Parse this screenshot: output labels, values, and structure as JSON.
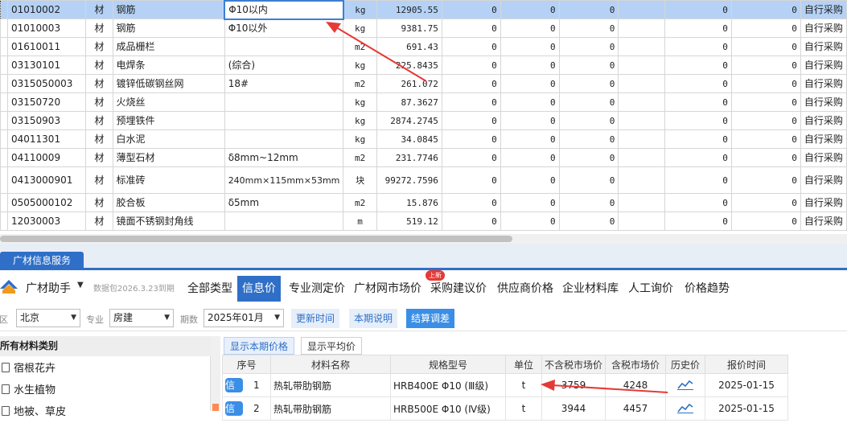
{
  "grid": {
    "rows": [
      {
        "code": "01010002",
        "type": "材",
        "name": "钢筋",
        "spec": "Φ10以内",
        "unit": "kg",
        "qty": "12905.55",
        "c1": "0",
        "c2": "0",
        "c3": "0",
        "c4": "",
        "c5": "0",
        "c6": "0",
        "supply": "自行采购",
        "selected": true,
        "tall": false
      },
      {
        "code": "01010003",
        "type": "材",
        "name": "钢筋",
        "spec": "Φ10以外",
        "unit": "kg",
        "qty": "9381.75",
        "c1": "0",
        "c2": "0",
        "c3": "0",
        "c4": "",
        "c5": "0",
        "c6": "0",
        "supply": "自行采购",
        "selected": false,
        "tall": false
      },
      {
        "code": "01610011",
        "type": "材",
        "name": "成品栅栏",
        "spec": "",
        "unit": "m2",
        "qty": "691.43",
        "c1": "0",
        "c2": "0",
        "c3": "0",
        "c4": "",
        "c5": "0",
        "c6": "0",
        "supply": "自行采购",
        "selected": false,
        "tall": false
      },
      {
        "code": "03130101",
        "type": "材",
        "name": "电焊条",
        "spec": "(综合)",
        "unit": "kg",
        "qty": "225.8435",
        "c1": "0",
        "c2": "0",
        "c3": "0",
        "c4": "",
        "c5": "0",
        "c6": "0",
        "supply": "自行采购",
        "selected": false,
        "tall": false
      },
      {
        "code": "0315050003",
        "type": "材",
        "name": "镀锌低碳钢丝网",
        "spec": "18#",
        "unit": "m2",
        "qty": "261.072",
        "c1": "0",
        "c2": "0",
        "c3": "0",
        "c4": "",
        "c5": "0",
        "c6": "0",
        "supply": "自行采购",
        "selected": false,
        "tall": false
      },
      {
        "code": "03150720",
        "type": "材",
        "name": "火烧丝",
        "spec": "",
        "unit": "kg",
        "qty": "87.3627",
        "c1": "0",
        "c2": "0",
        "c3": "0",
        "c4": "",
        "c5": "0",
        "c6": "0",
        "supply": "自行采购",
        "selected": false,
        "tall": false
      },
      {
        "code": "03150903",
        "type": "材",
        "name": "预埋铁件",
        "spec": "",
        "unit": "kg",
        "qty": "2874.2745",
        "c1": "0",
        "c2": "0",
        "c3": "0",
        "c4": "",
        "c5": "0",
        "c6": "0",
        "supply": "自行采购",
        "selected": false,
        "tall": false
      },
      {
        "code": "04011301",
        "type": "材",
        "name": "白水泥",
        "spec": "",
        "unit": "kg",
        "qty": "34.0845",
        "c1": "0",
        "c2": "0",
        "c3": "0",
        "c4": "",
        "c5": "0",
        "c6": "0",
        "supply": "自行采购",
        "selected": false,
        "tall": false
      },
      {
        "code": "04110009",
        "type": "材",
        "name": "薄型石材",
        "spec": "δ8mm~12mm",
        "unit": "m2",
        "qty": "231.7746",
        "c1": "0",
        "c2": "0",
        "c3": "0",
        "c4": "",
        "c5": "0",
        "c6": "0",
        "supply": "自行采购",
        "selected": false,
        "tall": false
      },
      {
        "code": "0413000901",
        "type": "材",
        "name": "标准砖",
        "spec": "240mm×115mm×53mm",
        "unit": "块",
        "qty": "99272.7596",
        "c1": "0",
        "c2": "0",
        "c3": "0",
        "c4": "",
        "c5": "0",
        "c6": "0",
        "supply": "自行采购",
        "selected": false,
        "tall": true
      },
      {
        "code": "0505000102",
        "type": "材",
        "name": "胶合板",
        "spec": "δ5mm",
        "unit": "m2",
        "qty": "15.876",
        "c1": "0",
        "c2": "0",
        "c3": "0",
        "c4": "",
        "c5": "0",
        "c6": "0",
        "supply": "自行采购",
        "selected": false,
        "tall": false
      },
      {
        "code": "12030003",
        "type": "材",
        "name": "镜面不锈钢封角线",
        "spec": "",
        "unit": "m",
        "qty": "519.12",
        "c1": "0",
        "c2": "0",
        "c3": "0",
        "c4": "",
        "c5": "0",
        "c6": "0",
        "supply": "自行采购",
        "selected": false,
        "tall": false
      }
    ]
  },
  "panel": {
    "tab_label": "广材信息服务",
    "brand": "广材助手",
    "package_info": "数据包2026.3.23到期",
    "nav": [
      {
        "label": "全部类型",
        "active": false
      },
      {
        "label": "信息价",
        "active": true
      },
      {
        "label": "专业测定价",
        "active": false
      },
      {
        "label": "广材网市场价",
        "active": false
      },
      {
        "label": "采购建议价",
        "active": false
      },
      {
        "label": "供应商价格",
        "active": false
      },
      {
        "label": "企业材料库",
        "active": false
      },
      {
        "label": "人工询价",
        "active": false
      },
      {
        "label": "价格趋势",
        "active": false
      }
    ],
    "new_badge": "上新",
    "filters": {
      "region_label": "地区",
      "region": "北京",
      "major_label": "专业",
      "major": "房建",
      "period_label": "期数",
      "period": "2025年01月",
      "btn_update": "更新时间",
      "btn_note": "本期说明",
      "btn_settle": "结算调差"
    },
    "categories_title": "所有材料类别",
    "categories": [
      "宿根花卉",
      "水生植物",
      "地被、草皮"
    ],
    "subtabs": [
      {
        "label": "显示本期价格",
        "active": true
      },
      {
        "label": "显示平均价",
        "active": false
      }
    ],
    "price_table": {
      "headers": [
        "序号",
        "材料名称",
        "规格型号",
        "单位",
        "不含税市场价",
        "含税市场价",
        "历史价",
        "报价时间"
      ],
      "badge": "信",
      "rows": [
        {
          "idx": "1",
          "name": "热轧带肋钢筋",
          "spec": "HRB400E Φ10 (Ⅲ级)",
          "unit": "t",
          "ex_tax": "3759",
          "in_tax": "4248",
          "date": "2025-01-15"
        },
        {
          "idx": "2",
          "name": "热轧带肋钢筋",
          "spec": "HRB500E Φ10 (Ⅳ级)",
          "unit": "t",
          "ex_tax": "3944",
          "in_tax": "4457",
          "date": "2025-01-15"
        }
      ]
    }
  },
  "colors": {
    "accent": "#2f6fc7",
    "selected_row": "#b5d2f6",
    "arrow": "#e53935",
    "badge": "#e53935"
  }
}
